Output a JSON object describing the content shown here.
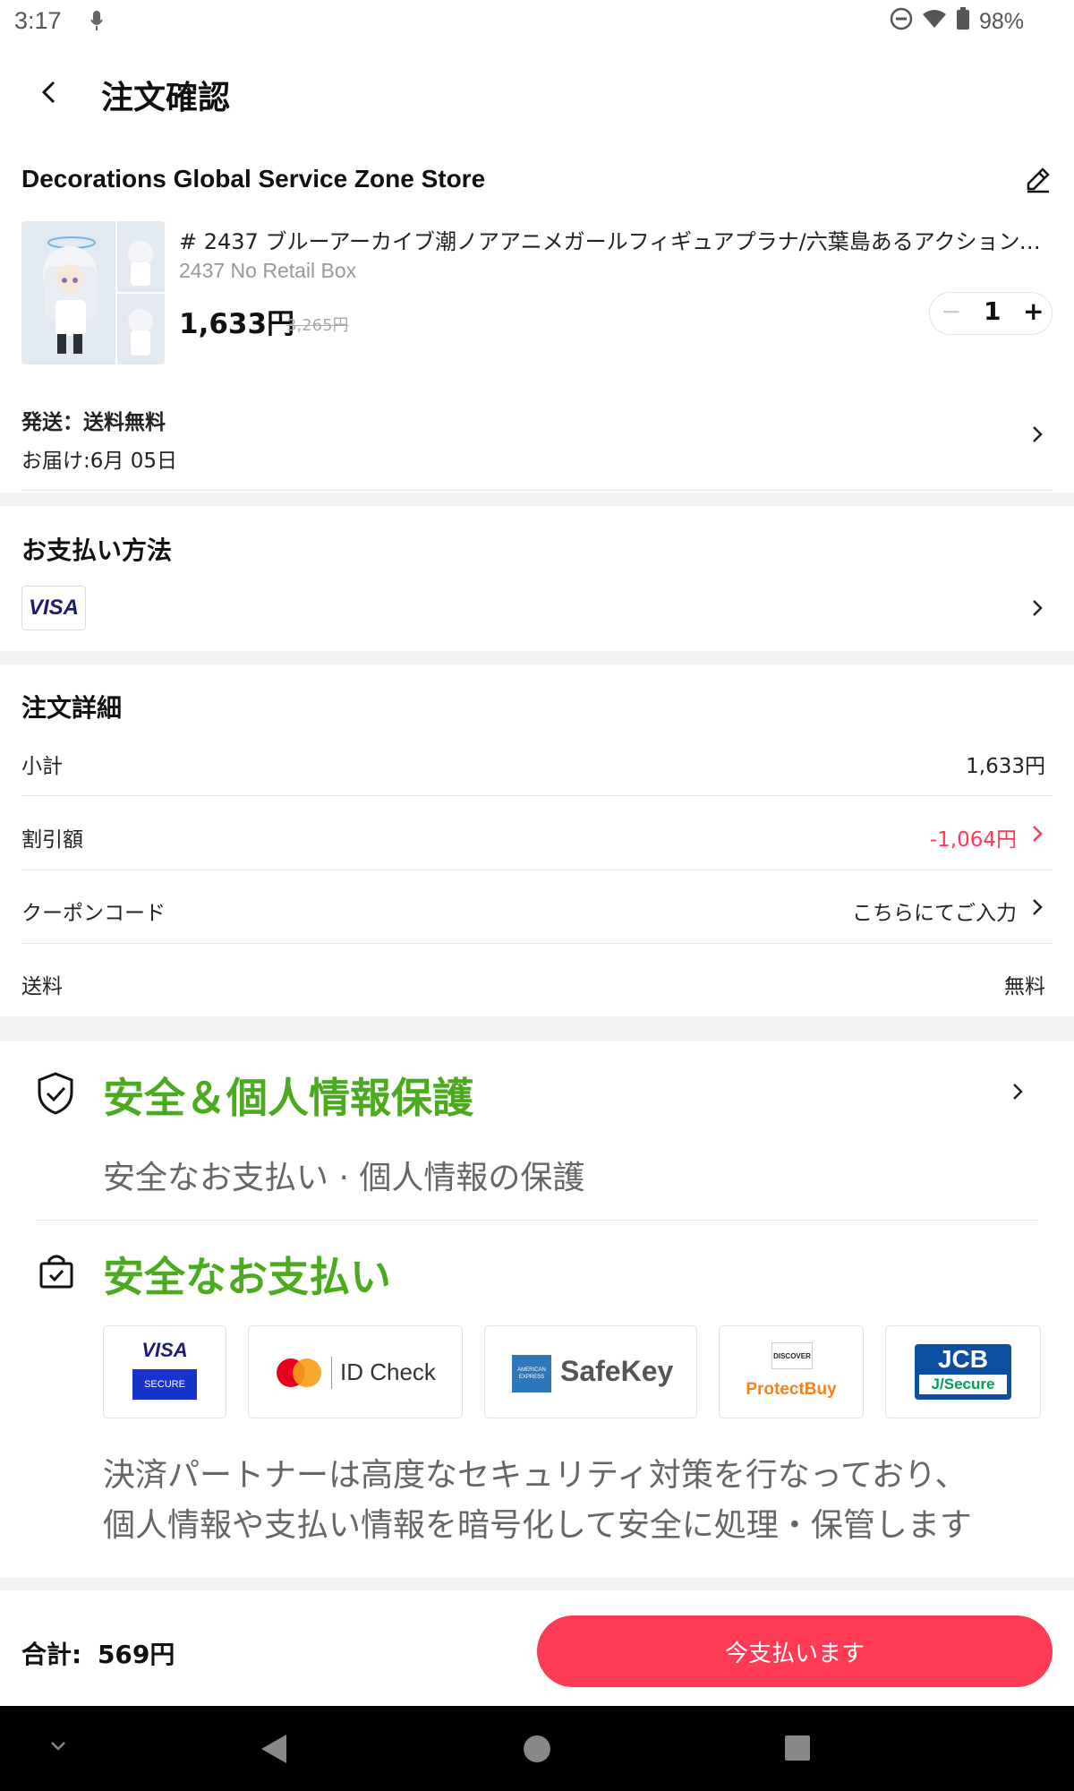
{
  "status_bar": {
    "time": "3:17",
    "battery": "98%"
  },
  "header": {
    "title": "注文確認"
  },
  "store": {
    "name": "Decorations Global Service Zone Store"
  },
  "product": {
    "title": "# 2437 ブルーアーカイブ潮ノアアニメガールフィギュアプラナ/六葉島あるアクションフ...",
    "variant": "2437 No Retail Box",
    "price": "1,633円",
    "original_price": "3,265円",
    "quantity": "1"
  },
  "shipping": {
    "method": "発送：送料無料",
    "delivery": "お届け:6月 05日"
  },
  "payment": {
    "title": "お支払い方法",
    "card": "VISA"
  },
  "order_details": {
    "title": "注文詳細",
    "rows": [
      {
        "label": "小計",
        "value": "1,633円"
      },
      {
        "label": "割引額",
        "value": "-1,064円"
      },
      {
        "label": "クーポンコード",
        "value": "こちらにてご入力"
      },
      {
        "label": "送料",
        "value": "無料"
      }
    ]
  },
  "security": {
    "title": "安全＆個人情報保護",
    "subtitle": "安全なお支払い · 個人情報の保護",
    "payment_title": "安全なお支払い",
    "logos": {
      "visa_top": "VISA",
      "visa_bottom": "SECURE",
      "mastercard": "ID Check",
      "amex_badge": "AMERICAN EXPRESS",
      "amex": "SafeKey",
      "discover_badge": "DISCOVER",
      "discover": "ProtectBuy",
      "jcb_top": "JCB",
      "jcb_bottom": "J/Secure"
    },
    "description_line1": "決済パートナーは高度なセキュリティ対策を行なっており、",
    "description_line2": "個人情報や支払い情報を暗号化して安全に処理・保管します"
  },
  "footer": {
    "total_label": "合計:",
    "total_value": "569円",
    "pay_button": "今支払います"
  },
  "colors": {
    "accent": "#fe3a55",
    "green": "#4caa1f",
    "discount": "#fe3a55"
  },
  "icons": [
    "back-icon",
    "edit-icon",
    "chevron-right-icon",
    "shield-check-icon",
    "secure-bag-icon"
  ]
}
